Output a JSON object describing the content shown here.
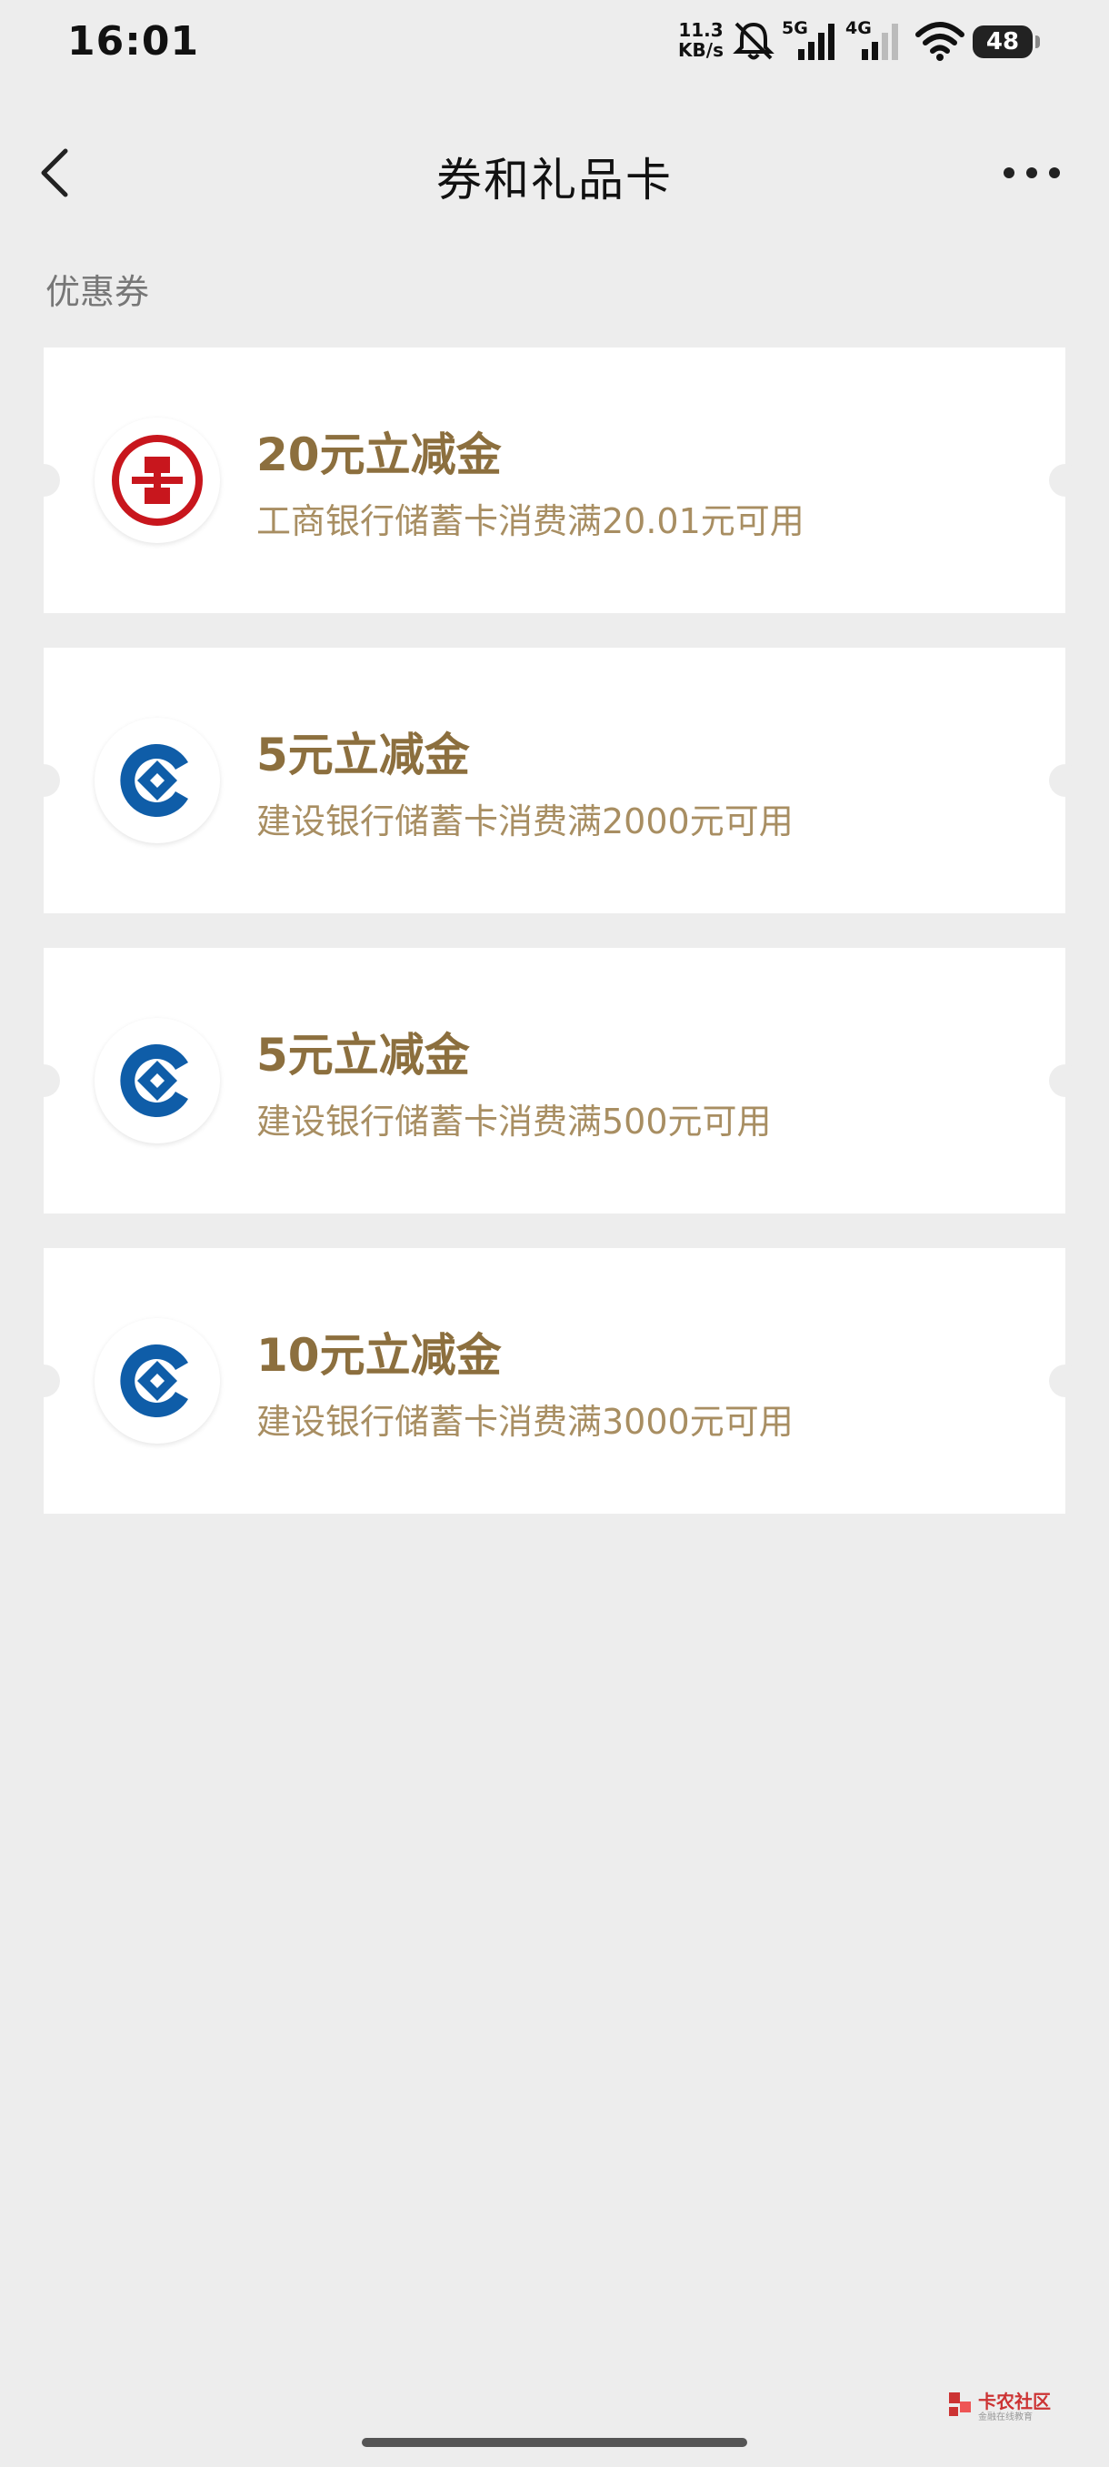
{
  "status_bar": {
    "time": "16:01",
    "net_speed_value": "11.3",
    "net_speed_unit": "KB/s",
    "signal1_label": "5G",
    "signal2_label": "4G",
    "battery": "48"
  },
  "header": {
    "title": "券和礼品卡"
  },
  "section": {
    "title": "优惠券"
  },
  "coupons": [
    {
      "title": "20元立减金",
      "description": "工商银行储蓄卡消费满20.01元可用",
      "bank_icon": "icbc-logo-icon"
    },
    {
      "title": "5元立减金",
      "description": "建设银行储蓄卡消费满2000元可用",
      "bank_icon": "ccb-logo-icon"
    },
    {
      "title": "5元立减金",
      "description": "建设银行储蓄卡消费满500元可用",
      "bank_icon": "ccb-logo-icon"
    },
    {
      "title": "10元立减金",
      "description": "建设银行储蓄卡消费满3000元可用",
      "bank_icon": "ccb-logo-icon"
    }
  ],
  "watermark": {
    "text": "卡农社区",
    "sub": "金融在线教育"
  },
  "colors": {
    "background": "#ededed",
    "coupon_title": "#8c6f3e",
    "coupon_desc": "#a88e62",
    "icbc_red": "#c8161d",
    "ccb_blue": "#0f5da8"
  }
}
